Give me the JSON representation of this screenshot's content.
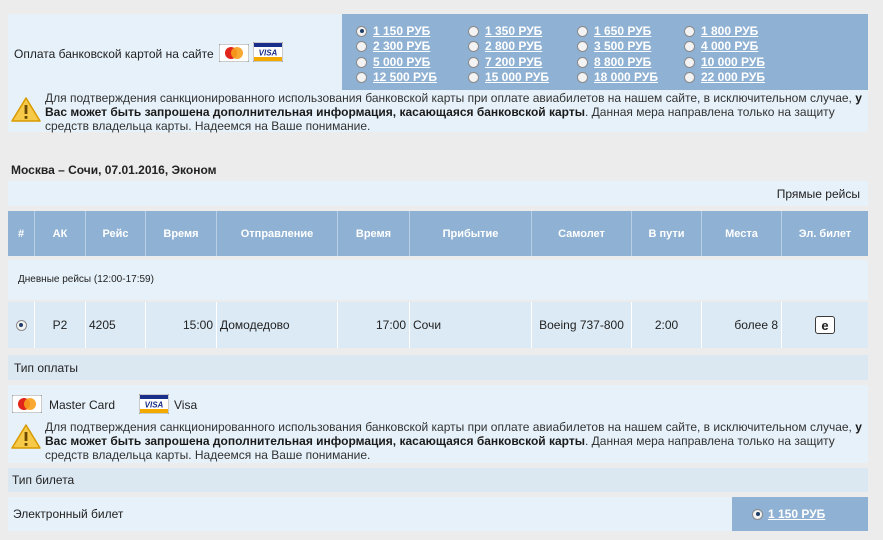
{
  "payment_top": {
    "label": "Оплата банковской картой на сайте",
    "cards": [
      "mastercard-icon",
      "visa-icon"
    ],
    "prices": [
      {
        "label": "1 150 РУБ",
        "selected": true
      },
      {
        "label": "1 350 РУБ",
        "selected": false
      },
      {
        "label": "1 650 РУБ",
        "selected": false
      },
      {
        "label": "1 800 РУБ",
        "selected": false
      },
      {
        "label": "2 300 РУБ",
        "selected": false
      },
      {
        "label": "2 800 РУБ",
        "selected": false
      },
      {
        "label": "3 500 РУБ",
        "selected": false
      },
      {
        "label": "4 000 РУБ",
        "selected": false
      },
      {
        "label": "5 000 РУБ",
        "selected": false
      },
      {
        "label": "7 200 РУБ",
        "selected": false
      },
      {
        "label": "8 800 РУБ",
        "selected": false
      },
      {
        "label": "10 000 РУБ",
        "selected": false
      },
      {
        "label": "12 500 РУБ",
        "selected": false
      },
      {
        "label": "15 000 РУБ",
        "selected": false
      },
      {
        "label": "18 000 РУБ",
        "selected": false
      },
      {
        "label": "22 000 РУБ",
        "selected": false
      }
    ]
  },
  "warning": {
    "text_pre": "Для подтверждения санкционированного использования банковской карты при оплате авиабилетов на нашем сайте, в исключительном случае,",
    "text_bold": "у Вас может быть запрошена дополнительная информация, касающаяся банковской карты",
    "text_post": ". Данная мера направлена только на защиту средств владельца карты. Надеемся на Ваше понимание."
  },
  "route": "Москва – Сочи, 07.01.2016, Эконом",
  "direct_flights": "Прямые рейсы",
  "table": {
    "headers": [
      "#",
      "АК",
      "Рейс",
      "Время",
      "Отправление",
      "Время",
      "Прибытие",
      "Самолет",
      "В пути",
      "Места",
      "Эл. билет"
    ],
    "group_label": "Дневные рейсы (12:00-17:59)",
    "row": {
      "selected": true,
      "airline": "Р2",
      "flight": "4205",
      "dep_time": "15:00",
      "departure": "Домодедово",
      "arr_time": "17:00",
      "arrival": "Сочи",
      "aircraft": "Boeing 737-800",
      "duration": "2:00",
      "seats": "более 8",
      "eticket": "e"
    }
  },
  "payment_type": {
    "title": "Тип оплаты",
    "mastercard": "Master Card",
    "visa": "Visa"
  },
  "ticket_type": {
    "title": "Тип билета",
    "label": "Электронный билет",
    "price": "1 150 РУБ",
    "selected": true
  },
  "colors": {
    "header": "#8fb1d3",
    "panel": "#e6f1f9",
    "row": "#dbeaf5"
  }
}
